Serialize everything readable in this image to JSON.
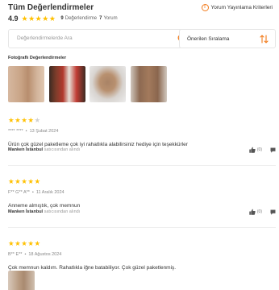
{
  "header": {
    "title": "Tüm Değerlendirmeler",
    "criteria_link": "Yorum Yayınlama Kriterleri",
    "average": "4.9",
    "stars_filled": 5,
    "rating_count": "9",
    "rating_label": "Değerlendirme",
    "review_count": "7",
    "review_label": "Yorum"
  },
  "search": {
    "placeholder": "Değerlendirmelerde Ara",
    "value": ""
  },
  "sort": {
    "label": "Önerilen Sıralama"
  },
  "photos": {
    "title": "Fotoğraflı Değerlendirmeler",
    "count": 4
  },
  "reviews": [
    {
      "stars": 4,
      "author": "**** ****",
      "date": "13 Şubat 2024",
      "comment": "Ürün çok güzel paketleme çok iyi rahatlıkla alabilirsiniz hediye için teşekkürler",
      "seller_name": "Manken İstanbul",
      "seller_suffix": "satıcısından alındı",
      "likes": "(0)"
    },
    {
      "stars": 5,
      "author": "F** G** A**",
      "date": "11 Aralık 2024",
      "comment": "Anneme almıştık, çok memnun",
      "seller_name": "Manken İstanbul",
      "seller_suffix": "satıcısından alındı",
      "likes": "(0)"
    },
    {
      "stars": 5,
      "author": "B** E**",
      "date": "18 Ağustos 2024",
      "comment": "Çok memnun kaldım. Rahatlıkla iğne batabiliyor. Çok güzel paketlenmiş."
    }
  ],
  "colors": {
    "star": "#ffc000",
    "accent": "#f27a1a"
  }
}
